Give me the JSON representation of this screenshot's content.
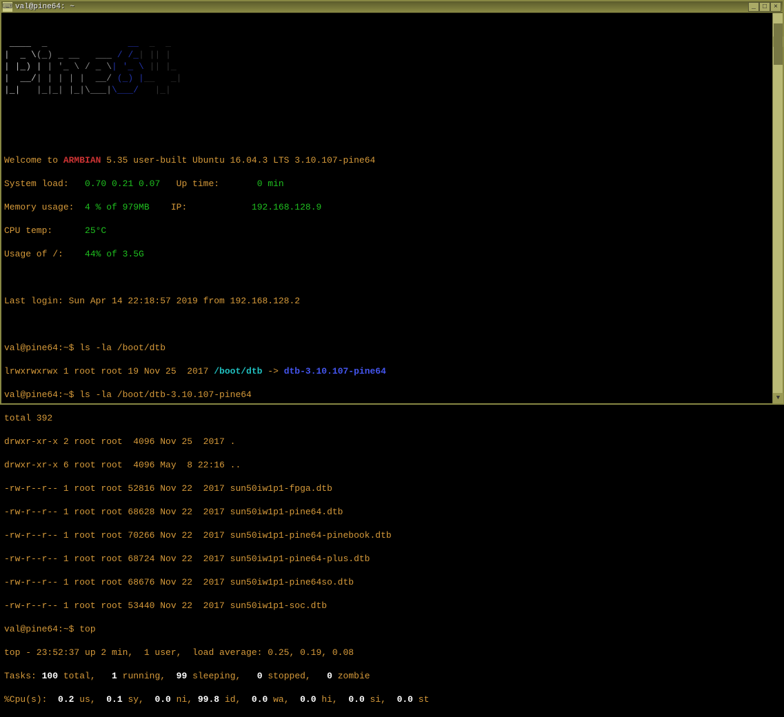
{
  "window": {
    "title": "val@pine64: ~"
  },
  "ascii": {
    "row1a": " ____  ",
    "row1b": "_              ",
    "row1c": " __ ",
    "row1d": " ",
    "row1e": "_  _   ",
    "row2a": "|  _ \\",
    "row2b": "(_) _ __   ___ ",
    "row2c": "/ /_",
    "row2d": "| || |  ",
    "row3a": "| |_) |",
    "row3b": " | '_ \\ / _ \\",
    "row3c": "| '_ \\",
    "row3d": " || |_ ",
    "row4a": "|  __/",
    "row4b": "| | | | |  __/",
    "row4c": " (_) |",
    "row4d": "__   _|",
    "row5a": "|_|   ",
    "row5b": "|_|_| |_|\\___|",
    "row5c": "\\___/  ",
    "row5d": " |_|  "
  },
  "motd": {
    "welcome_pre": "Welcome to ",
    "armbian": "ARMBIAN",
    "welcome_post": " 5.35 user-built Ubuntu 16.04.3 LTS 3.10.107-pine64",
    "load_label": "System load:   ",
    "load_val": "0.70 0.21 0.07",
    "uptime_label": "   Up time:       ",
    "uptime_val": "0 min",
    "mem_label": "Memory usage:  ",
    "mem_val": "4 % of 979MB",
    "ip_label": "    IP:            ",
    "ip_val": "192.168.128.9",
    "cpu_label": "CPU temp:      ",
    "cpu_val": "25°C",
    "disk_label": "Usage of /:    ",
    "disk_val": "44% of 3.5G",
    "lastlogin": "Last login: Sun Apr 14 22:18:57 2019 from 192.168.128.2"
  },
  "prompt": "val@pine64:~$ ",
  "cmd1": "ls -la /boot/dtb",
  "ls1": {
    "perm": "lrwxrwxrwx 1 root root 19 Nov 25  2017 ",
    "name": "/boot/dtb",
    "arrow": " -> ",
    "target": "dtb-3.10.107-pine64"
  },
  "cmd2": "ls -la /boot/dtb-3.10.107-pine64",
  "ls2": {
    "total": "total 392",
    "rows": [
      "drwxr-xr-x 2 root root  4096 Nov 25  2017 .",
      "drwxr-xr-x 6 root root  4096 May  8 22:16 ..",
      "-rw-r--r-- 1 root root 52816 Nov 22  2017 sun50iw1p1-fpga.dtb",
      "-rw-r--r-- 1 root root 68628 Nov 22  2017 sun50iw1p1-pine64.dtb",
      "-rw-r--r-- 1 root root 70266 Nov 22  2017 sun50iw1p1-pine64-pinebook.dtb",
      "-rw-r--r-- 1 root root 68724 Nov 22  2017 sun50iw1p1-pine64-plus.dtb",
      "-rw-r--r-- 1 root root 68676 Nov 22  2017 sun50iw1p1-pine64so.dtb",
      "-rw-r--r-- 1 root root 53440 Nov 22  2017 sun50iw1p1-soc.dtb"
    ]
  },
  "cmd3": "top",
  "top": {
    "line1_a": "top - 23:52:37 up 2 min,  1 user,  load average: 0.25, 0.19, 0.08",
    "tasks_pre": "Tasks: ",
    "tasks_total": "100",
    "tasks_mid1": " total,   ",
    "tasks_run": "1",
    "tasks_mid2": " running,  ",
    "tasks_sleep": "99",
    "tasks_mid3": " sleeping,   ",
    "tasks_stop": "0",
    "tasks_mid4": " stopped,   ",
    "tasks_zomb": "0",
    "tasks_end": " zombie",
    "cpu_pre": "%Cpu(s):  ",
    "cpu_us": "0.2",
    "cpu_l1": " us,  ",
    "cpu_sy": "0.1",
    "cpu_l2": " sy,  ",
    "cpu_ni": "0.0",
    "cpu_l3": " ni, ",
    "cpu_id": "99.8",
    "cpu_l4": " id,  ",
    "cpu_wa": "0.0",
    "cpu_l5": " wa,  ",
    "cpu_hi": "0.0",
    "cpu_l6": " hi,  ",
    "cpu_si": "0.0",
    "cpu_l7": " si,  ",
    "cpu_st": "0.0",
    "cpu_l8": " st"
  }
}
